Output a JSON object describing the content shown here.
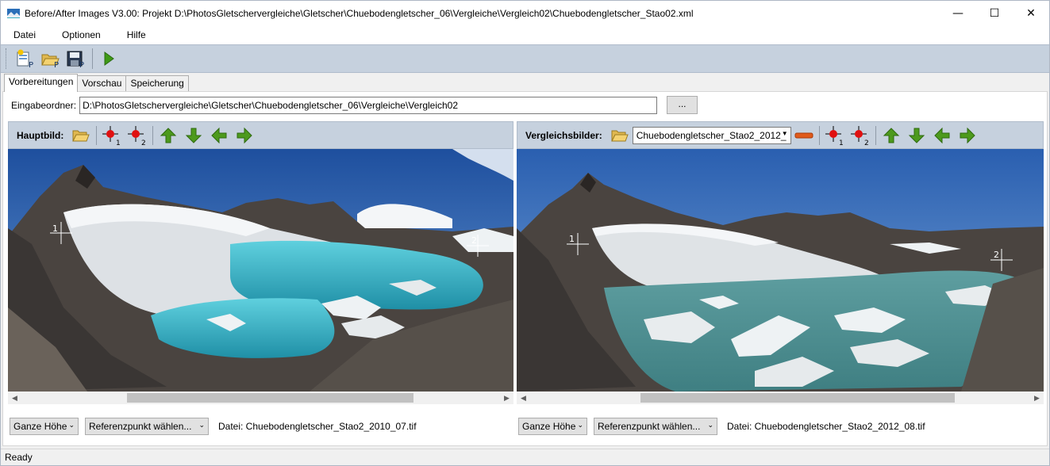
{
  "window": {
    "title": "Before/After Images V3.00: Projekt D:\\PhotosGletschervergleiche\\Gletscher\\Chuebodengletscher_06\\Vergleiche\\Vergleich02\\Chuebodengletscher_Stao02.xml",
    "minimize": "—",
    "maximize": "☐",
    "close": "✕"
  },
  "menu": {
    "file": "Datei",
    "options": "Optionen",
    "help": "Hilfe"
  },
  "tabs": [
    {
      "label": "Vorbereitungen",
      "active": true
    },
    {
      "label": "Vorschau",
      "active": false
    },
    {
      "label": "Speicherung",
      "active": false
    }
  ],
  "input_folder": {
    "label": "Eingabeordner:",
    "value": "D:\\PhotosGletschervergleiche\\Gletscher\\Chuebodengletscher_06\\Vergleiche\\Vergleich02",
    "browse_label": "..."
  },
  "main_panel": {
    "label": "Hauptbild:",
    "marker1": "1",
    "marker2": "2",
    "height_select": "Ganze Höhe",
    "ref_select": "Referenzpunkt wählen...",
    "file_label": "Datei: Chuebodengletscher_Stao2_2010_07.tif",
    "scroll_thumb_start": 0.22,
    "scroll_thumb_size": 0.6
  },
  "compare_panel": {
    "label": "Vergleichsbilder:",
    "image_select": "Chuebodengletscher_Stao2_2012_",
    "marker1": "1",
    "marker2": "2",
    "height_select": "Ganze Höhe",
    "ref_select": "Referenzpunkt wählen...",
    "file_label": "Datei: Chuebodengletscher_Stao2_2012_08.tif",
    "scroll_thumb_start": 0.22,
    "scroll_thumb_size": 0.63
  },
  "status": "Ready",
  "colors": {
    "toolbar_bg": "#c6d1de",
    "arrow_green": "#4d9a1d",
    "marker_red": "#e01010",
    "sky": "#2a5fb0",
    "lake_left": "#3fb2c4",
    "lake_right": "#4f8f90",
    "ice": "#e6e9ec"
  },
  "icons": {
    "new_project": "new-project-icon",
    "open_project": "open-project-icon",
    "save_project": "save-project-icon",
    "run": "play-icon",
    "open_folder": "folder-open-icon",
    "ref_point_1": "red-marker-1-icon",
    "ref_point_2": "red-marker-2-icon",
    "arrow_up": "arrow-up-icon",
    "arrow_down": "arrow-down-icon",
    "arrow_left": "arrow-left-icon",
    "arrow_right": "arrow-right-icon",
    "remove": "minus-icon"
  }
}
